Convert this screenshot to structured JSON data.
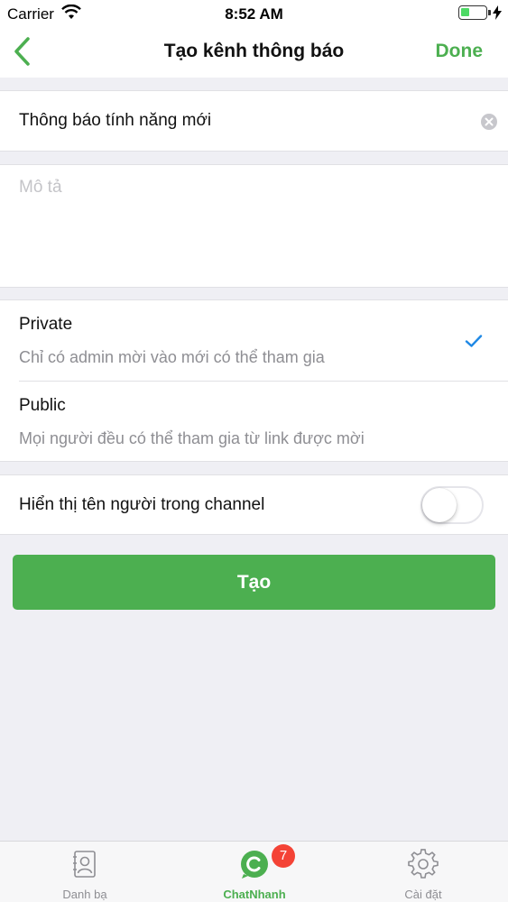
{
  "status_bar": {
    "carrier": "Carrier",
    "time": "8:52 AM",
    "battery_percent": 35
  },
  "nav": {
    "title": "Tạo kênh thông báo",
    "done_label": "Done",
    "back_icon": "chevron-left-icon"
  },
  "form": {
    "name_value": "Thông báo tính năng mới",
    "description_placeholder": "Mô tả",
    "description_value": "",
    "privacy_options": [
      {
        "title": "Private",
        "description": "Chỉ có admin mời vào mới có thể tham gia",
        "selected": true
      },
      {
        "title": "Public",
        "description": "Mọi người đều có thể tham gia từ link được mời",
        "selected": false
      }
    ],
    "show_names_label": "Hiển thị tên người trong channel",
    "show_names_enabled": false,
    "create_label": "Tạo"
  },
  "tab_bar": {
    "tabs": [
      {
        "label": "Danh bạ",
        "icon": "contacts-icon",
        "active": false
      },
      {
        "label": "ChatNhanh",
        "icon": "chat-icon",
        "active": true,
        "badge": "7"
      },
      {
        "label": "Cài đặt",
        "icon": "gear-icon",
        "active": false
      }
    ]
  },
  "colors": {
    "accent": "#4caf50",
    "background": "#efeff4",
    "check": "#1e88e5",
    "badge": "#f44336",
    "placeholder": "#c4c4c8",
    "secondary_text": "#8e8e93"
  }
}
